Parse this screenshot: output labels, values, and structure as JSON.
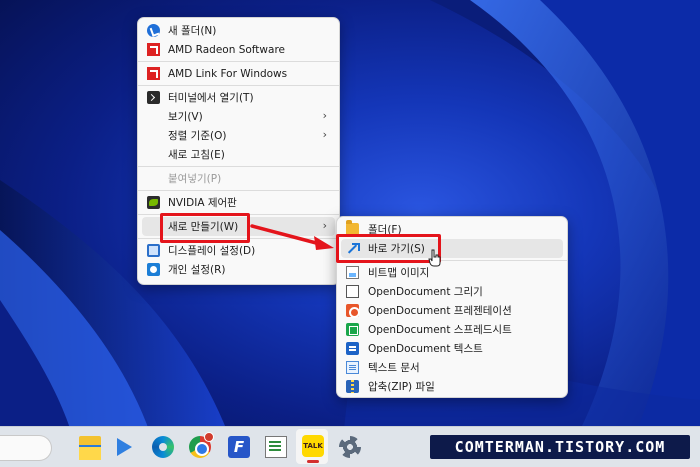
{
  "context_menu": {
    "items": [
      {
        "label": "새 폴더(N)",
        "icon": "new-folder-icon"
      },
      {
        "label": "AMD Radeon Software",
        "icon": "amd-icon"
      },
      {
        "label": "AMD Link For Windows",
        "icon": "amd-icon"
      },
      {
        "label": "터미널에서 열기(T)",
        "icon": "terminal-icon"
      },
      {
        "label": "보기(V)",
        "has_submenu": true
      },
      {
        "label": "정렬 기준(O)",
        "has_submenu": true
      },
      {
        "label": "새로 고침(E)"
      },
      {
        "label": "붙여넣기(P)",
        "disabled": true
      },
      {
        "label": "NVIDIA 제어판",
        "icon": "nvidia-icon"
      },
      {
        "label": "새로 만들기(W)",
        "has_submenu": true,
        "highlighted": true
      },
      {
        "label": "디스플레이 설정(D)",
        "icon": "display-icon"
      },
      {
        "label": "개인 설정(R)",
        "icon": "personalize-icon"
      }
    ],
    "submenu_arrow": "›"
  },
  "new_submenu": {
    "items": [
      {
        "label": "폴더(F)",
        "icon": "folder-icon"
      },
      {
        "label": "바로 가기(S)",
        "icon": "shortcut-icon",
        "highlighted": true
      },
      {
        "label": "비트맵 이미지",
        "icon": "bitmap-icon"
      },
      {
        "label": "OpenDocument 그리기",
        "icon": "document-icon"
      },
      {
        "label": "OpenDocument 프레젠테이션",
        "icon": "presentation-icon"
      },
      {
        "label": "OpenDocument 스프레드시트",
        "icon": "spreadsheet-icon"
      },
      {
        "label": "OpenDocument 텍스트",
        "icon": "text-document-icon"
      },
      {
        "label": "텍스트 문서",
        "icon": "text-file-icon"
      },
      {
        "label": "압축(ZIP) 파일",
        "icon": "zip-icon"
      }
    ]
  },
  "taskbar": {
    "apps": [
      "search-box",
      "file-explorer-icon",
      "media-player-icon",
      "edge-icon",
      "chrome-icon",
      "f-app-icon",
      "notepad-icon",
      "kakaotalk-icon",
      "settings-icon"
    ],
    "kakaotalk_label": "TALK",
    "f_app_label": "F"
  },
  "watermark": "COMTERMAN.TISTORY.COM",
  "colors": {
    "annotation_red": "#e4141b",
    "menu_bg": "#f9f9f9",
    "taskbar_bg": "#dfe4ea"
  }
}
